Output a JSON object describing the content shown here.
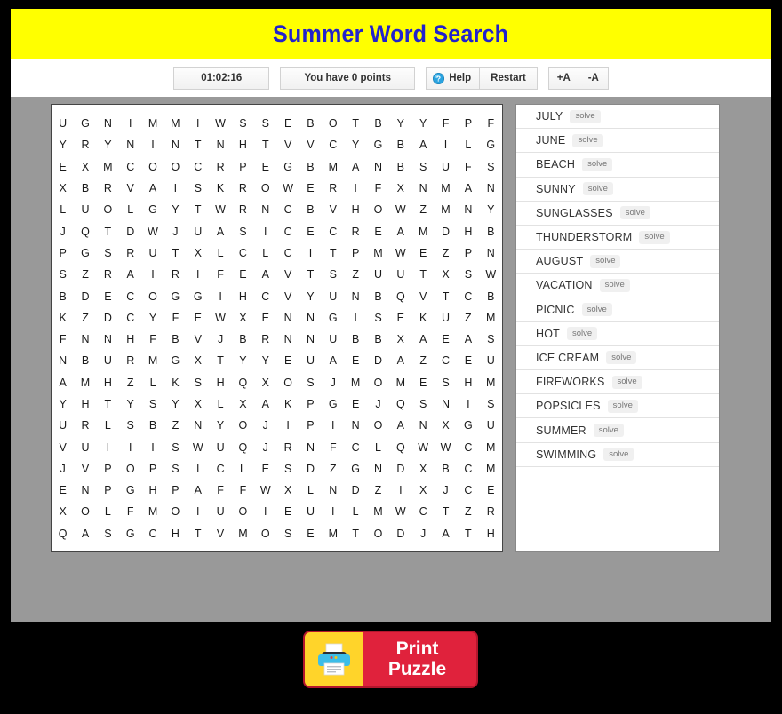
{
  "header": {
    "title": "Summer Word Search",
    "bg_color": "#ffff00",
    "title_color": "#2222cc"
  },
  "toolbar": {
    "timer": "01:02:16",
    "points": "You have 0 points",
    "help_label": "Help",
    "help_icon": "question-mark-circle-icon",
    "restart_label": "Restart",
    "increase_font_label": "+A",
    "decrease_font_label": "-A"
  },
  "grid": {
    "rows": 20,
    "cols": 20,
    "letters": [
      [
        "U",
        "G",
        "N",
        "I",
        "M",
        "M",
        "I",
        "W",
        "S",
        "S",
        "E",
        "B",
        "O",
        "T",
        "B",
        "Y",
        "Y",
        "F",
        "P",
        "F"
      ],
      [
        "Y",
        "R",
        "Y",
        "N",
        "I",
        "N",
        "T",
        "N",
        "H",
        "T",
        "V",
        "V",
        "C",
        "Y",
        "G",
        "B",
        "A",
        "I",
        "L",
        "G"
      ],
      [
        "E",
        "X",
        "M",
        "C",
        "O",
        "O",
        "C",
        "R",
        "P",
        "E",
        "G",
        "B",
        "M",
        "A",
        "N",
        "B",
        "S",
        "U",
        "F",
        "S"
      ],
      [
        "X",
        "B",
        "R",
        "V",
        "A",
        "I",
        "S",
        "K",
        "R",
        "O",
        "W",
        "E",
        "R",
        "I",
        "F",
        "X",
        "N",
        "M",
        "A",
        "N"
      ],
      [
        "L",
        "U",
        "O",
        "L",
        "G",
        "Y",
        "T",
        "W",
        "R",
        "N",
        "C",
        "B",
        "V",
        "H",
        "O",
        "W",
        "Z",
        "M",
        "N",
        "Y"
      ],
      [
        "J",
        "Q",
        "T",
        "D",
        "W",
        "J",
        "U",
        "A",
        "S",
        "I",
        "C",
        "E",
        "C",
        "R",
        "E",
        "A",
        "M",
        "D",
        "H",
        "B"
      ],
      [
        "P",
        "G",
        "S",
        "R",
        "U",
        "T",
        "X",
        "L",
        "C",
        "L",
        "C",
        "I",
        "T",
        "P",
        "M",
        "W",
        "E",
        "Z",
        "P",
        "N"
      ],
      [
        "S",
        "Z",
        "R",
        "A",
        "I",
        "R",
        "I",
        "F",
        "E",
        "A",
        "V",
        "T",
        "S",
        "Z",
        "U",
        "U",
        "T",
        "X",
        "S",
        "W"
      ],
      [
        "B",
        "D",
        "E",
        "C",
        "O",
        "G",
        "G",
        "I",
        "H",
        "C",
        "V",
        "Y",
        "U",
        "N",
        "B",
        "Q",
        "V",
        "T",
        "C",
        "B"
      ],
      [
        "K",
        "Z",
        "D",
        "C",
        "Y",
        "F",
        "E",
        "W",
        "X",
        "E",
        "N",
        "N",
        "G",
        "I",
        "S",
        "E",
        "K",
        "U",
        "Z",
        "M"
      ],
      [
        "F",
        "N",
        "N",
        "H",
        "F",
        "B",
        "V",
        "J",
        "B",
        "R",
        "N",
        "N",
        "U",
        "B",
        "B",
        "X",
        "A",
        "E",
        "A",
        "S"
      ],
      [
        "N",
        "B",
        "U",
        "R",
        "M",
        "G",
        "X",
        "T",
        "Y",
        "Y",
        "E",
        "U",
        "A",
        "E",
        "D",
        "A",
        "Z",
        "C",
        "E",
        "U"
      ],
      [
        "A",
        "M",
        "H",
        "Z",
        "L",
        "K",
        "S",
        "H",
        "Q",
        "X",
        "O",
        "S",
        "J",
        "M",
        "O",
        "M",
        "E",
        "S",
        "H",
        "M"
      ],
      [
        "Y",
        "H",
        "T",
        "Y",
        "S",
        "Y",
        "X",
        "L",
        "X",
        "A",
        "K",
        "P",
        "G",
        "E",
        "J",
        "Q",
        "S",
        "N",
        "I",
        "S"
      ],
      [
        "U",
        "R",
        "L",
        "S",
        "B",
        "Z",
        "N",
        "Y",
        "O",
        "J",
        "I",
        "P",
        "I",
        "N",
        "O",
        "A",
        "N",
        "X",
        "G",
        "U"
      ],
      [
        "V",
        "U",
        "I",
        "I",
        "I",
        "S",
        "W",
        "U",
        "Q",
        "J",
        "R",
        "N",
        "F",
        "C",
        "L",
        "Q",
        "W",
        "W",
        "C",
        "M"
      ],
      [
        "J",
        "V",
        "P",
        "O",
        "P",
        "S",
        "I",
        "C",
        "L",
        "E",
        "S",
        "D",
        "Z",
        "G",
        "N",
        "D",
        "X",
        "B",
        "C",
        "M"
      ],
      [
        "E",
        "N",
        "P",
        "G",
        "H",
        "P",
        "A",
        "F",
        "F",
        "W",
        "X",
        "L",
        "N",
        "D",
        "Z",
        "I",
        "X",
        "J",
        "C",
        "E"
      ],
      [
        "X",
        "O",
        "L",
        "F",
        "M",
        "O",
        "I",
        "U",
        "O",
        "I",
        "E",
        "U",
        "I",
        "L",
        "M",
        "W",
        "C",
        "T",
        "Z",
        "R"
      ],
      [
        "Q",
        "A",
        "S",
        "G",
        "C",
        "H",
        "T",
        "V",
        "M",
        "O",
        "S",
        "E",
        "M",
        "T",
        "O",
        "D",
        "J",
        "A",
        "T",
        "H"
      ]
    ]
  },
  "word_list": {
    "solve_label": "solve",
    "words": [
      "JULY",
      "JUNE",
      "BEACH",
      "SUNNY",
      "SUNGLASSES",
      "THUNDERSTORM",
      "AUGUST",
      "VACATION",
      "PICNIC",
      "HOT",
      "ICE CREAM",
      "FIREWORKS",
      "POPSICLES",
      "SUMMER",
      "SWIMMING"
    ]
  },
  "print": {
    "line1": "Print",
    "line2": "Puzzle",
    "icon": "printer-icon",
    "bg_color": "#e0223c",
    "icon_bg_color": "#ffd42a"
  }
}
